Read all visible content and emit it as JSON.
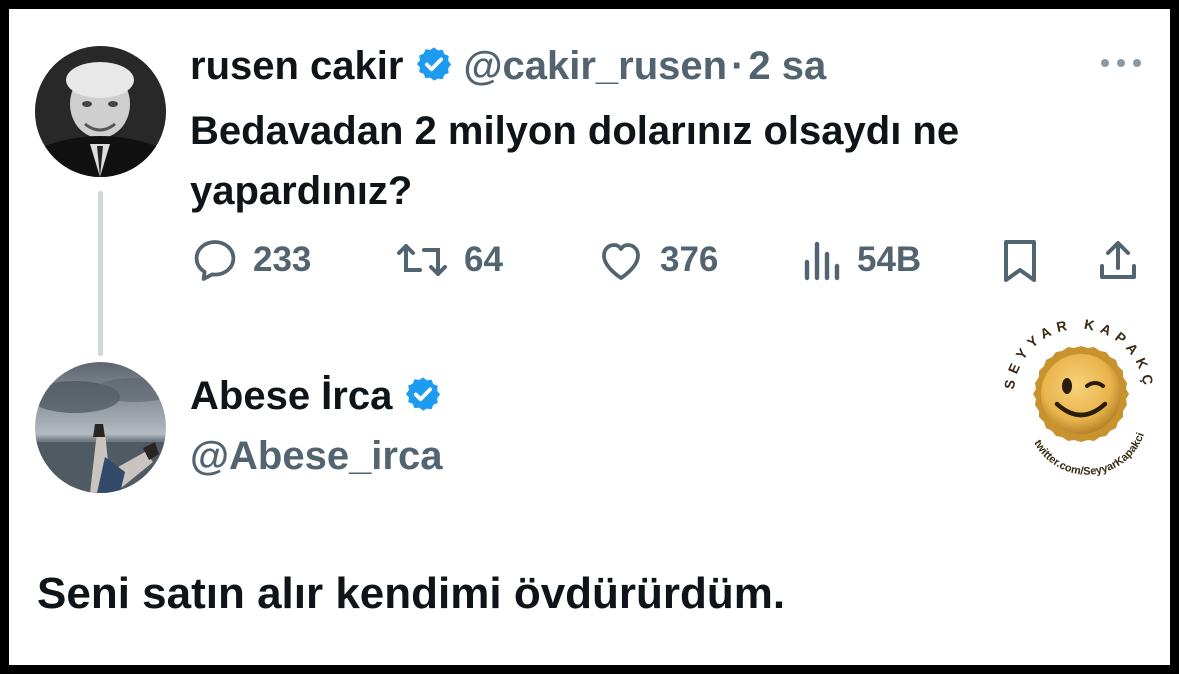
{
  "tweet": {
    "author_name": "rusen cakir",
    "author_handle": "@cakir_rusen",
    "separator": "·",
    "time": "2 sa",
    "text": "Bedavadan 2 milyon dolarınız olsaydı ne yapardınız?",
    "actions": {
      "replies": "233",
      "retweets": "64",
      "likes": "376",
      "views": "54B"
    }
  },
  "reply": {
    "author_name": "Abese İrca",
    "author_handle": "@Abese_irca",
    "text": "Seni satın alır kendimi övdürürdüm."
  },
  "watermark": {
    "top_text": "SEYYAR KAPAKÇI",
    "bottom_text": "twitter.com/SeyyarKapakci"
  },
  "colors": {
    "verified_blue": "#1d9bf0",
    "muted": "#536471",
    "text": "#0f1419",
    "thread_line": "#cfd9de",
    "cap_gold": "#e9b44c"
  },
  "icons": [
    "verified-badge-icon",
    "more-icon",
    "reply-icon",
    "retweet-icon",
    "like-icon",
    "views-icon",
    "bookmark-icon",
    "share-icon",
    "bottle-cap-logo"
  ]
}
